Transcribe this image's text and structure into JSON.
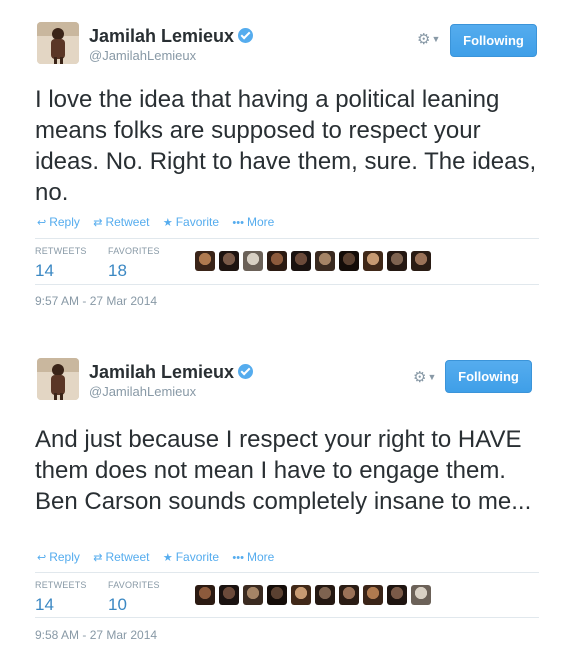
{
  "tweets": [
    {
      "author": {
        "fullname": "Jamilah Lemieux",
        "username": "@JamilahLemieux",
        "verified": true
      },
      "gear_icon": "gear-icon",
      "follow_label": "Following",
      "text": "I love the idea that having a political leaning means folks are supposed to respect your ideas. No. Right to have them, sure. The ideas, no.",
      "actions": {
        "reply": "Reply",
        "retweet": "Retweet",
        "favorite": "Favorite",
        "more": "More"
      },
      "stats": {
        "retweets_label": "RETWEETS",
        "retweets": "14",
        "favorites_label": "FAVORITES",
        "favorites": "18"
      },
      "favoriter_avatars": 10,
      "timestamp": "9:57 AM - 27 Mar 2014"
    },
    {
      "author": {
        "fullname": "Jamilah Lemieux",
        "username": "@JamilahLemieux",
        "verified": true
      },
      "gear_icon": "gear-icon",
      "follow_label": "Following",
      "text": "And just because I respect your right to HAVE them does not mean I have to engage them. Ben Carson sounds completely insane to me...",
      "actions": {
        "reply": "Reply",
        "retweet": "Retweet",
        "favorite": "Favorite",
        "more": "More"
      },
      "stats": {
        "retweets_label": "RETWEETS",
        "retweets": "14",
        "favorites_label": "FAVORITES",
        "favorites": "10"
      },
      "favoriter_avatars": 10,
      "timestamp": "9:58 AM - 27 Mar 2014"
    }
  ],
  "colors": {
    "accent": "#55acee",
    "text": "#292f33",
    "muted": "#8899a6",
    "count": "#3b88c3"
  }
}
